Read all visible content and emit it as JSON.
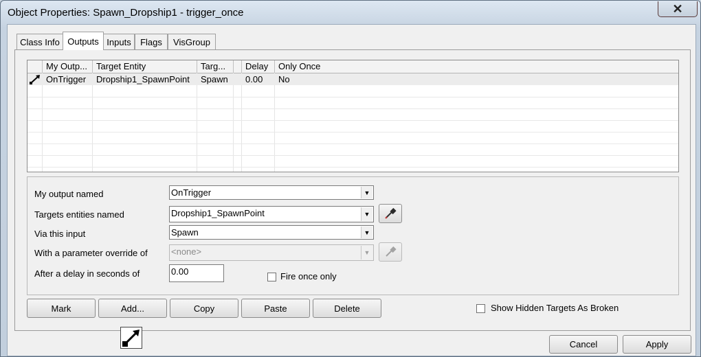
{
  "window": {
    "title": "Object Properties: Spawn_Dropship1 - trigger_once",
    "close_glyph": "✕"
  },
  "tabs": [
    "Class Info",
    "Outputs",
    "Inputs",
    "Flags",
    "VisGroup"
  ],
  "outputs_list": {
    "columns": [
      "My Outp...",
      "Target Entity",
      "Targ...",
      "",
      "Delay",
      "Only Once"
    ],
    "rows": [
      {
        "output": "OnTrigger",
        "target": "Dropship1_SpawnPoint",
        "input": "Spawn",
        "param": "",
        "delay": "0.00",
        "only_once": "No"
      }
    ]
  },
  "form": {
    "output_label": "My output named",
    "output_value": "OnTrigger",
    "targets_label": "Targets entities named",
    "targets_value": "Dropship1_SpawnPoint",
    "input_label": "Via this input",
    "input_value": "Spawn",
    "param_label": "With a parameter override of",
    "param_value": "<none>",
    "delay_label": "After a delay in seconds of",
    "delay_value": "0.00",
    "fire_once_label": "Fire once only",
    "fire_once_checked": false
  },
  "actions": {
    "mark": "Mark",
    "add": "Add...",
    "copy": "Copy",
    "paste": "Paste",
    "delete": "Delete",
    "show_hidden_label": "Show Hidden Targets As Broken",
    "show_hidden_checked": false
  },
  "footer": {
    "cancel": "Cancel",
    "apply": "Apply"
  },
  "icons": {
    "output_arrow": "output-arrow-icon",
    "eyedropper": "eyedropper-icon"
  }
}
